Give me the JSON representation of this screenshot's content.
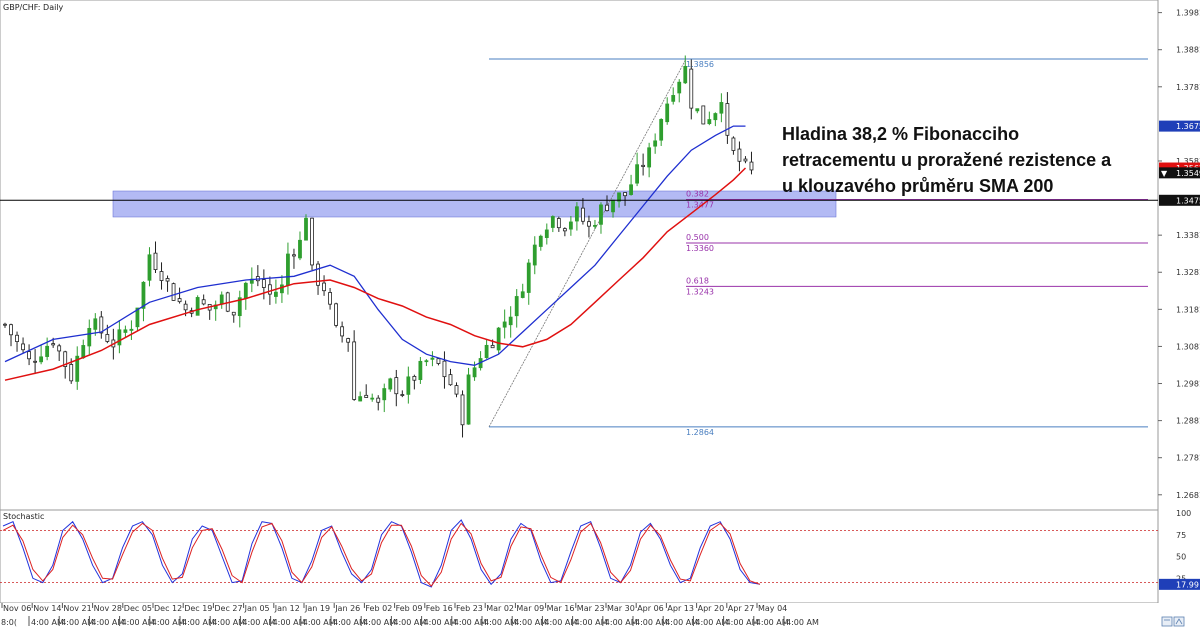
{
  "chart_data": [
    {
      "type": "candlestick",
      "title": "GBP/CHF: Daily",
      "price_axis_ticks": [
        "1.3981",
        "1.3881",
        "1.3781",
        "1.3581",
        "1.3381",
        "1.3281",
        "1.3181",
        "1.3081",
        "1.2981",
        "1.2881",
        "1.2781",
        "1.2681"
      ],
      "ylim": [
        1.264,
        1.4015
      ],
      "current_price": "1.3549",
      "price_markers": [
        {
          "label": "1.3675",
          "value": 1.3675,
          "bg": "#1f3fb8",
          "fg": "#ffffff"
        },
        {
          "label": "1.3562",
          "value": 1.3562,
          "bg": "#e01010",
          "fg": "#ffffff"
        },
        {
          "label": "1.3549",
          "value": 1.3549,
          "bg": "#111111",
          "fg": "#ffffff"
        },
        {
          "label": "1.3475",
          "value": 1.3475,
          "bg": "#111111",
          "fg": "#ffffff"
        }
      ],
      "horizontal_line": {
        "value": 1.3475,
        "color": "#000000"
      },
      "zone": {
        "from": 1.343,
        "to": 1.35,
        "color": "#9aa3f0"
      },
      "fibonacci": {
        "high": {
          "value": 1.3856,
          "label": "1.3856"
        },
        "low": {
          "value": 1.2864,
          "label": "1.2864"
        },
        "levels": [
          {
            "ratio": "0.382",
            "value": 1.3477,
            "label": "1.3477"
          },
          {
            "ratio": "0.500",
            "value": 1.336,
            "label": "1.3360"
          },
          {
            "ratio": "0.618",
            "value": 1.3243,
            "label": "1.3243"
          }
        ]
      },
      "annotation": [
        "Hladina 38,2 % Fibonacciho",
        "retracementu u proražené rezistence a",
        "u klouzavého průměru SMA 200"
      ],
      "x_tick_labels": [
        "Nov 06",
        "Nov 14",
        "Nov 21",
        "Nov 28",
        "Dec 05",
        "Dec 12",
        "Dec 19",
        "Dec 27",
        "Jan 05",
        "Jan 12",
        "Jan 19",
        "Jan 26",
        "Feb 02",
        "Feb 09",
        "Feb 16",
        "Feb 23",
        "Mar 02",
        "Mar 09",
        "Mar 16",
        "Mar 23",
        "Mar 30",
        "Apr 06",
        "Apr 13",
        "Apr 20",
        "Apr 27",
        "May 04"
      ],
      "x_ticks_per_label": 3,
      "close_path": [
        [
          0,
          1.314
        ],
        [
          4,
          1.304
        ],
        [
          8,
          1.31
        ],
        [
          11,
          1.3
        ],
        [
          14,
          1.315
        ],
        [
          18,
          1.309
        ],
        [
          21,
          1.314
        ],
        [
          23,
          1.325
        ],
        [
          24,
          1.333
        ],
        [
          26,
          1.328
        ],
        [
          28,
          1.322
        ],
        [
          30,
          1.318
        ],
        [
          32,
          1.32
        ],
        [
          34,
          1.318
        ],
        [
          36,
          1.321
        ],
        [
          38,
          1.318
        ],
        [
          40,
          1.325
        ],
        [
          42,
          1.326
        ],
        [
          44,
          1.322
        ],
        [
          46,
          1.324
        ],
        [
          47,
          1.333
        ],
        [
          49,
          1.336
        ],
        [
          50,
          1.344
        ],
        [
          51,
          1.328
        ],
        [
          53,
          1.324
        ],
        [
          55,
          1.312
        ],
        [
          57,
          1.31
        ],
        [
          58,
          1.294
        ],
        [
          60,
          1.296
        ],
        [
          62,
          1.292
        ],
        [
          64,
          1.298
        ],
        [
          66,
          1.296
        ],
        [
          68,
          1.3
        ],
        [
          70,
          1.304
        ],
        [
          72,
          1.303
        ],
        [
          74,
          1.298
        ],
        [
          76,
          1.289
        ],
        [
          77,
          1.299
        ],
        [
          79,
          1.306
        ],
        [
          81,
          1.31
        ],
        [
          83,
          1.315
        ],
        [
          85,
          1.32
        ],
        [
          87,
          1.33
        ],
        [
          89,
          1.34
        ],
        [
          91,
          1.343
        ],
        [
          93,
          1.341
        ],
        [
          95,
          1.344
        ],
        [
          97,
          1.34
        ],
        [
          99,
          1.345
        ],
        [
          101,
          1.348
        ],
        [
          103,
          1.349
        ],
        [
          105,
          1.355
        ],
        [
          107,
          1.36
        ],
        [
          109,
          1.37
        ],
        [
          111,
          1.378
        ],
        [
          113,
          1.383
        ],
        [
          114,
          1.374
        ],
        [
          116,
          1.369
        ],
        [
          118,
          1.372
        ],
        [
          119,
          1.376
        ],
        [
          120,
          1.363
        ],
        [
          121,
          1.36
        ],
        [
          123,
          1.356
        ],
        [
          124,
          1.3549
        ]
      ],
      "sma_fast_path": [
        [
          0,
          1.304
        ],
        [
          8,
          1.31
        ],
        [
          16,
          1.312
        ],
        [
          24,
          1.32
        ],
        [
          32,
          1.324
        ],
        [
          40,
          1.326
        ],
        [
          48,
          1.327
        ],
        [
          54,
          1.33
        ],
        [
          58,
          1.327
        ],
        [
          62,
          1.318
        ],
        [
          66,
          1.31
        ],
        [
          70,
          1.306
        ],
        [
          74,
          1.304
        ],
        [
          78,
          1.303
        ],
        [
          82,
          1.306
        ],
        [
          86,
          1.312
        ],
        [
          90,
          1.318
        ],
        [
          94,
          1.324
        ],
        [
          98,
          1.33
        ],
        [
          102,
          1.338
        ],
        [
          106,
          1.346
        ],
        [
          110,
          1.354
        ],
        [
          114,
          1.361
        ],
        [
          118,
          1.365
        ],
        [
          121,
          1.3675
        ],
        [
          123,
          1.3675
        ]
      ],
      "sma_slow_path": [
        [
          0,
          1.299
        ],
        [
          8,
          1.302
        ],
        [
          16,
          1.307
        ],
        [
          24,
          1.314
        ],
        [
          32,
          1.318
        ],
        [
          40,
          1.321
        ],
        [
          48,
          1.325
        ],
        [
          54,
          1.326
        ],
        [
          58,
          1.324
        ],
        [
          62,
          1.321
        ],
        [
          66,
          1.319
        ],
        [
          70,
          1.316
        ],
        [
          74,
          1.314
        ],
        [
          78,
          1.311
        ],
        [
          82,
          1.309
        ],
        [
          86,
          1.308
        ],
        [
          90,
          1.31
        ],
        [
          94,
          1.314
        ],
        [
          98,
          1.32
        ],
        [
          102,
          1.326
        ],
        [
          106,
          1.332
        ],
        [
          110,
          1.339
        ],
        [
          114,
          1.344
        ],
        [
          118,
          1.349
        ],
        [
          121,
          1.353
        ],
        [
          123,
          1.3562
        ]
      ]
    },
    {
      "type": "line",
      "title": "Stochastic",
      "ylim": [
        0,
        100
      ],
      "y_ticks": [
        "100",
        "75",
        "50",
        "25"
      ],
      "levels": [
        80,
        20
      ],
      "current_value": "17.99",
      "series": [
        {
          "color": "#2233dd",
          "values": [
            85,
            90,
            60,
            25,
            20,
            40,
            80,
            90,
            70,
            40,
            20,
            25,
            60,
            85,
            90,
            75,
            40,
            20,
            30,
            70,
            85,
            80,
            50,
            20,
            22,
            65,
            90,
            88,
            60,
            25,
            20,
            45,
            80,
            85,
            55,
            30,
            20,
            35,
            75,
            90,
            85,
            55,
            20,
            15,
            40,
            80,
            92,
            70,
            35,
            18,
            30,
            70,
            88,
            80,
            45,
            20,
            22,
            55,
            85,
            90,
            60,
            25,
            20,
            40,
            78,
            88,
            70,
            40,
            20,
            25,
            60,
            85,
            90,
            70,
            35,
            20,
            18
          ]
        },
        {
          "color": "#dd2222",
          "values": [
            80,
            86,
            68,
            35,
            22,
            35,
            72,
            86,
            75,
            48,
            25,
            24,
            52,
            78,
            88,
            80,
            48,
            24,
            26,
            60,
            80,
            82,
            58,
            28,
            20,
            55,
            84,
            88,
            68,
            32,
            20,
            38,
            72,
            84,
            62,
            36,
            22,
            30,
            66,
            86,
            86,
            62,
            28,
            16,
            32,
            70,
            88,
            76,
            42,
            22,
            26,
            62,
            84,
            82,
            52,
            26,
            20,
            46,
            78,
            88,
            66,
            32,
            20,
            34,
            70,
            86,
            74,
            46,
            24,
            22,
            52,
            80,
            88,
            76,
            42,
            22,
            18
          ]
        }
      ]
    }
  ],
  "colors": {
    "fast_sma": "#1f2fd0",
    "slow_sma": "#e01010",
    "bull": "#2f9e2f",
    "bear": "#222222",
    "fib_main": "#4a7fc0",
    "fib_level": "#9933aa",
    "grid_dots": "#cc2222"
  },
  "bottom_axis": {
    "left_label": "8:0(",
    "repeat_label": "4:00 AM",
    "repeat_count": 26
  }
}
